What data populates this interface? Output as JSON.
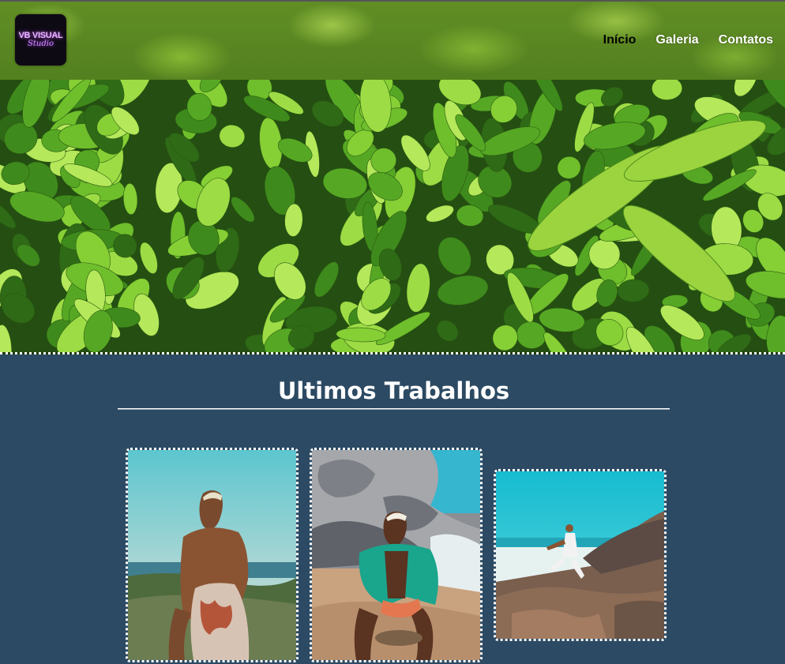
{
  "header": {
    "logo": {
      "line1": "VB VISUAL",
      "line2": "Studio"
    },
    "nav": [
      {
        "label": "Início",
        "active": true
      },
      {
        "label": "Galeria",
        "active": false
      },
      {
        "label": "Contatos",
        "active": false
      }
    ]
  },
  "works": {
    "title": "Ultimos Trabalhos"
  },
  "colors": {
    "background": "#2c4a63",
    "leaf_green": "#7cc62e",
    "accent_text": "#ffffff",
    "active_nav": "#000000"
  }
}
